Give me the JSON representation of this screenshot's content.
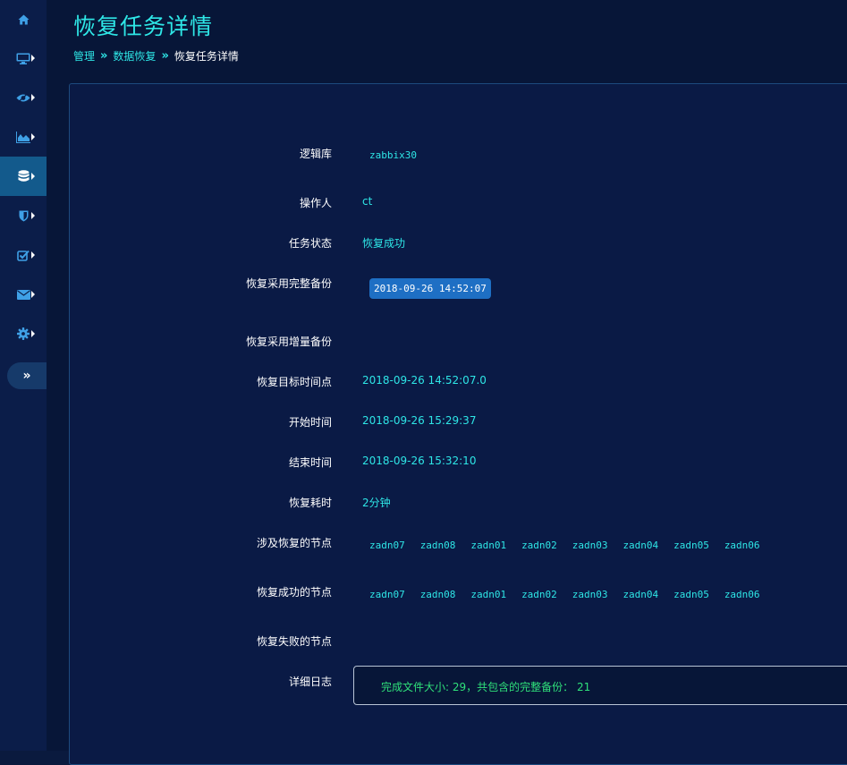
{
  "page_title": "恢复任务详情",
  "breadcrumb": {
    "items": [
      "管理",
      "数据恢复"
    ],
    "current": "恢复任务详情",
    "separator": "»"
  },
  "sidebar": {
    "items": [
      {
        "icon": "home-icon",
        "active": false,
        "has_caret": false
      },
      {
        "icon": "desktop-icon",
        "active": false,
        "has_caret": true
      },
      {
        "icon": "eye-icon",
        "active": false,
        "has_caret": true
      },
      {
        "icon": "area-chart-icon",
        "active": false,
        "has_caret": true
      },
      {
        "icon": "database-icon",
        "active": true,
        "has_caret": true
      },
      {
        "icon": "shield-icon",
        "active": false,
        "has_caret": true
      },
      {
        "icon": "check-square-icon",
        "active": false,
        "has_caret": true
      },
      {
        "icon": "envelope-icon",
        "active": false,
        "has_caret": true
      },
      {
        "icon": "gear-icon",
        "active": false,
        "has_caret": true
      }
    ],
    "toggle_label": "»"
  },
  "details": {
    "logical_db": {
      "label": "逻辑库",
      "value": "zabbix30"
    },
    "operator": {
      "label": "操作人",
      "value": "ct"
    },
    "status": {
      "label": "任务状态",
      "value": "恢复成功"
    },
    "full_backup": {
      "label": "恢复采用完整备份",
      "value": "2018-09-26 14:52:07"
    },
    "incr_backup": {
      "label": "恢复采用增量备份",
      "value": ""
    },
    "target_time": {
      "label": "恢复目标时间点",
      "value": "2018-09-26 14:52:07.0"
    },
    "start_time": {
      "label": "开始时间",
      "value": "2018-09-26 15:29:37"
    },
    "end_time": {
      "label": "结束时间",
      "value": "2018-09-26 15:32:10"
    },
    "duration": {
      "label": "恢复耗时",
      "value": "2分钟"
    },
    "involved_nodes": {
      "label": "涉及恢复的节点",
      "values": [
        "zadn07",
        "zadn08",
        "zadn01",
        "zadn02",
        "zadn03",
        "zadn04",
        "zadn05",
        "zadn06"
      ]
    },
    "success_nodes": {
      "label": "恢复成功的节点",
      "values": [
        "zadn07",
        "zadn08",
        "zadn01",
        "zadn02",
        "zadn03",
        "zadn04",
        "zadn05",
        "zadn06"
      ]
    },
    "failed_nodes": {
      "label": "恢复失败的节点",
      "values": []
    },
    "log": {
      "label": "详细日志",
      "value": "完成文件大小: 29，共包含的完整备份： 21"
    }
  },
  "colors": {
    "accent": "#2ee6e6",
    "sidebar_bg": "#0b1d49",
    "active_item": "#135a8c",
    "chip_bg": "#1e6fc4",
    "log_text": "#2fe07a"
  }
}
